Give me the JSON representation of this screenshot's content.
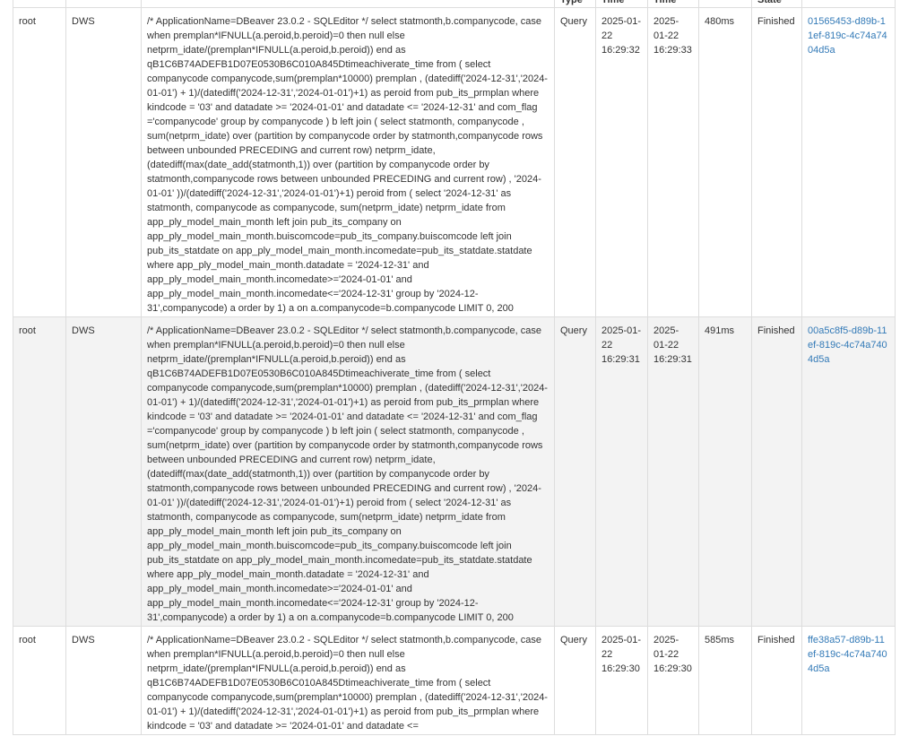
{
  "headers": [
    {
      "label": ""
    },
    {
      "label": ""
    },
    {
      "label": ""
    },
    {
      "label": "Type"
    },
    {
      "label": "Time"
    },
    {
      "label": "Time"
    },
    {
      "label": ""
    },
    {
      "label": "State"
    },
    {
      "label": ""
    },
    {
      "label": ""
    }
  ],
  "rows": [
    {
      "user": "root",
      "db": "DWS",
      "info": "/* ApplicationName=DBeaver 23.0.2 - SQLEditor */ select statmonth,b.companycode, case when premplan*IFNULL(a.peroid,b.peroid)=0 then null else netprm_idate/(premplan*IFNULL(a.peroid,b.peroid)) end as qB1C6B74ADEFB1D07E0530B6C010A845Dtimeachiverate_time from ( select companycode companycode,sum(premplan*10000) premplan , (datediff('2024-12-31','2024-01-01') + 1)/(datediff('2024-12-31','2024-01-01')+1) as peroid from pub_its_prmplan where kindcode = '03' and datadate >= '2024-01-01' and datadate <= '2024-12-31' and com_flag ='companycode' group by companycode ) b left join ( select statmonth, companycode , sum(netprm_idate) over (partition by companycode order by statmonth,companycode rows between unbounded PRECEDING and current row) netprm_idate, (datediff(max(date_add(statmonth,1)) over (partition by companycode order by statmonth,companycode rows between unbounded PRECEDING and current row) , '2024-01-01' ))/(datediff('2024-12-31','2024-01-01')+1) peroid from ( select '2024-12-31' as statmonth, companycode as companycode, sum(netprm_idate) netprm_idate from app_ply_model_main_month left join pub_its_company on app_ply_model_main_month.buiscomcode=pub_its_company.buiscomcode left join pub_its_statdate on app_ply_model_main_month.incomedate=pub_its_statdate.statdate where app_ply_model_main_month.datadate = '2024-12-31' and app_ply_model_main_month.incomedate>='2024-01-01' and app_ply_model_main_month.incomedate<='2024-12-31' group by '2024-12-31',companycode) a order by 1) a on a.companycode=b.companycode LIMIT 0, 200",
      "command": "Query",
      "start_time": "2025-01-22 16:29:32",
      "end_time": "2025-01-22 16:29:33",
      "duration": "480ms",
      "state": "Finished",
      "query_id": "01565453-d89b-11ef-819c-4c74a7404d5a"
    },
    {
      "user": "root",
      "db": "DWS",
      "info": "/* ApplicationName=DBeaver 23.0.2 - SQLEditor */ select statmonth,b.companycode, case when premplan*IFNULL(a.peroid,b.peroid)=0 then null else netprm_idate/(premplan*IFNULL(a.peroid,b.peroid)) end as qB1C6B74ADEFB1D07E0530B6C010A845Dtimeachiverate_time from ( select companycode companycode,sum(premplan*10000) premplan , (datediff('2024-12-31','2024-01-01') + 1)/(datediff('2024-12-31','2024-01-01')+1) as peroid from pub_its_prmplan where kindcode = '03' and datadate >= '2024-01-01' and datadate <= '2024-12-31' and com_flag ='companycode' group by companycode ) b left join ( select statmonth, companycode , sum(netprm_idate) over (partition by companycode order by statmonth,companycode rows between unbounded PRECEDING and current row) netprm_idate, (datediff(max(date_add(statmonth,1)) over (partition by companycode order by statmonth,companycode rows between unbounded PRECEDING and current row) , '2024-01-01' ))/(datediff('2024-12-31','2024-01-01')+1) peroid from ( select '2024-12-31' as statmonth, companycode as companycode, sum(netprm_idate) netprm_idate from app_ply_model_main_month left join pub_its_company on app_ply_model_main_month.buiscomcode=pub_its_company.buiscomcode left join pub_its_statdate on app_ply_model_main_month.incomedate=pub_its_statdate.statdate where app_ply_model_main_month.datadate = '2024-12-31' and app_ply_model_main_month.incomedate>='2024-01-01' and app_ply_model_main_month.incomedate<='2024-12-31' group by '2024-12-31',companycode) a order by 1) a on a.companycode=b.companycode LIMIT 0, 200",
      "command": "Query",
      "start_time": "2025-01-22 16:29:31",
      "end_time": "2025-01-22 16:29:31",
      "duration": "491ms",
      "state": "Finished",
      "query_id": "00a5c8f5-d89b-11ef-819c-4c74a7404d5a"
    },
    {
      "user": "root",
      "db": "DWS",
      "info": "/* ApplicationName=DBeaver 23.0.2 - SQLEditor */ select statmonth,b.companycode, case when premplan*IFNULL(a.peroid,b.peroid)=0 then null else netprm_idate/(premplan*IFNULL(a.peroid,b.peroid)) end as qB1C6B74ADEFB1D07E0530B6C010A845Dtimeachiverate_time from ( select companycode companycode,sum(premplan*10000) premplan , (datediff('2024-12-31','2024-01-01') + 1)/(datediff('2024-12-31','2024-01-01')+1) as peroid from pub_its_prmplan where kindcode = '03' and datadate >= '2024-01-01' and datadate <=",
      "command": "Query",
      "start_time": "2025-01-22 16:29:30",
      "end_time": "2025-01-22 16:29:30",
      "duration": "585ms",
      "state": "Finished",
      "query_id": "ffe38a57-d89b-11ef-819c-4c74a7404d5a"
    }
  ]
}
